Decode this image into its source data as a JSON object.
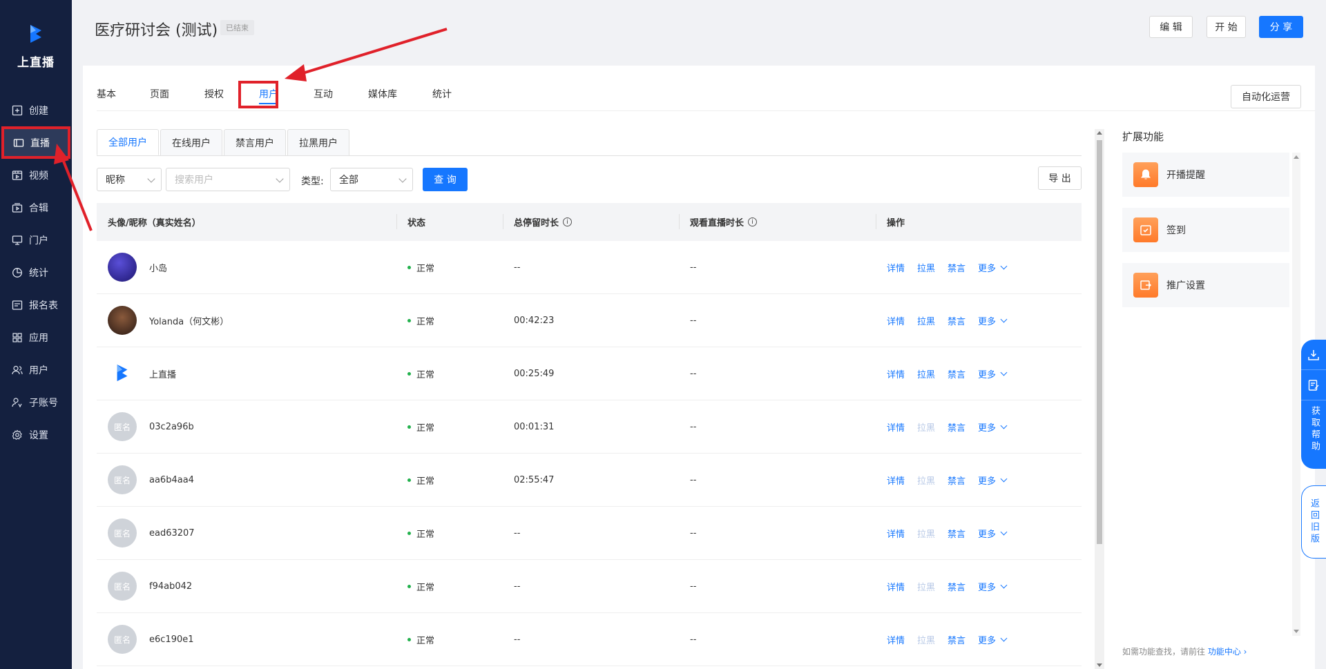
{
  "app": {
    "name": "上直播",
    "brand_color": "#1677ff",
    "sidebar_color": "#14203f"
  },
  "sidebar": {
    "items": [
      {
        "label": "创建",
        "icon": "plus-square-icon"
      },
      {
        "label": "直播",
        "icon": "live-camera-icon",
        "active": true
      },
      {
        "label": "视频",
        "icon": "video-icon"
      },
      {
        "label": "合辑",
        "icon": "collection-icon"
      },
      {
        "label": "门户",
        "icon": "monitor-icon"
      },
      {
        "label": "统计",
        "icon": "pie-chart-icon"
      },
      {
        "label": "报名表",
        "icon": "form-icon"
      },
      {
        "label": "应用",
        "icon": "apps-grid-icon"
      },
      {
        "label": "用户",
        "icon": "users-icon"
      },
      {
        "label": "子账号",
        "icon": "sub-account-icon"
      },
      {
        "label": "设置",
        "icon": "gear-icon"
      }
    ]
  },
  "header": {
    "title": "医疗研讨会 (测试)",
    "status_badge": "已结束",
    "edit_label": "编 辑",
    "start_label": "开 始",
    "share_label": "分 享"
  },
  "tabs": [
    {
      "label": "基本"
    },
    {
      "label": "页面"
    },
    {
      "label": "授权"
    },
    {
      "label": "用户",
      "active": true
    },
    {
      "label": "互动"
    },
    {
      "label": "媒体库"
    },
    {
      "label": "统计"
    }
  ],
  "auto_ops_label": "自动化运营",
  "subtabs": [
    {
      "label": "全部用户",
      "active": true
    },
    {
      "label": "在线用户"
    },
    {
      "label": "禁言用户"
    },
    {
      "label": "拉黑用户"
    }
  ],
  "filters": {
    "field_select": "昵称",
    "search_placeholder": "搜索用户",
    "type_label": "类型:",
    "type_select": "全部",
    "query_label": "查 询",
    "export_label": "导 出"
  },
  "table": {
    "columns": [
      "头像/昵称（真实姓名）",
      "状态",
      "总停留时长",
      "观看直播时长",
      "操作"
    ],
    "actions": {
      "detail": "详情",
      "blacklist": "拉黑",
      "mute": "禁言",
      "more": "更多"
    },
    "rows": [
      {
        "name": "小岛",
        "avatar": "photo-purple",
        "status": "正常",
        "stay": "--",
        "watch": "--",
        "blacklist_enabled": true
      },
      {
        "name": "Yolanda（何文彬）",
        "avatar": "photo-dark",
        "status": "正常",
        "stay": "00:42:23",
        "watch": "--",
        "blacklist_enabled": true
      },
      {
        "name": "上直播",
        "avatar": "logo",
        "status": "正常",
        "stay": "00:25:49",
        "watch": "--",
        "blacklist_enabled": true
      },
      {
        "name": "03c2a96b",
        "avatar": "匿名",
        "status": "正常",
        "stay": "00:01:31",
        "watch": "--",
        "blacklist_enabled": false
      },
      {
        "name": "aa6b4aa4",
        "avatar": "匿名",
        "status": "正常",
        "stay": "02:55:47",
        "watch": "--",
        "blacklist_enabled": false
      },
      {
        "name": "ead63207",
        "avatar": "匿名",
        "status": "正常",
        "stay": "--",
        "watch": "--",
        "blacklist_enabled": false
      },
      {
        "name": "f94ab042",
        "avatar": "匿名",
        "status": "正常",
        "stay": "--",
        "watch": "--",
        "blacklist_enabled": false
      },
      {
        "name": "e6c190e1",
        "avatar": "匿名",
        "status": "正常",
        "stay": "--",
        "watch": "--",
        "blacklist_enabled": false
      }
    ]
  },
  "extensions": {
    "title": "扩展功能",
    "items": [
      {
        "label": "开播提醒",
        "icon": "bell-icon"
      },
      {
        "label": "签到",
        "icon": "check-calendar-icon"
      },
      {
        "label": "推广设置",
        "icon": "share-box-icon"
      }
    ],
    "footer_text": "如需功能查找，请前往",
    "footer_link": "功能中心 ›"
  },
  "float_help": {
    "text": "获取帮助"
  },
  "float_old": {
    "text": "返回旧版"
  }
}
